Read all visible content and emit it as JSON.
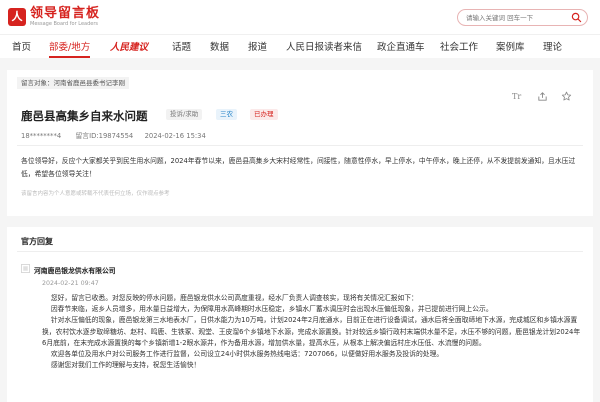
{
  "header": {
    "logo_mark": "人",
    "logo_title": "领导留言板",
    "logo_subtitle": "Message Board for Leaders",
    "search_placeholder": "请输入关键词 回车一下"
  },
  "nav": {
    "items": [
      "首页",
      "部委/地方",
      "人民建议",
      "话题",
      "数据",
      "报道",
      "人民日报读者来信",
      "政企直通车",
      "社会工作",
      "案例库",
      "理论"
    ]
  },
  "message": {
    "breadcrumb": "留言对象：河南省鹿邑县委书记李刚",
    "title": "鹿邑县高集乡自来水问题",
    "tags": [
      "投诉/求助",
      "三农",
      "已办理"
    ],
    "author": "18********4",
    "id_text": "留言ID:19874554",
    "date": "2024-02-16 15:34",
    "font_toggle": "Tr",
    "body": "各位领导好，反应个大家都关乎到民生用水问题，2024年春节以来，鹿邑县高集乡大宋村经常性，间接性，随意性停水，早上停水，中午停水，晚上还停，从不发提前发通知，且水压过低，希望各位领导关注！",
    "disclaimer": "该留言内容为个人意愿或转载不代表任何立场，仅作观点参考"
  },
  "reply": {
    "section_title": "官方回复",
    "org": "河南鹿邑银龙供水有限公司",
    "time": "2024-02-21 09:47",
    "paragraphs": [
      "您好，留言已收悉。对您反映的停水问题，鹿邑银龙供水公司高度重视，经水厂负责人调查核实，现将有关情况汇报如下：",
      "因春节来临，返乡人员增多，用水量日益增大，为保障用水高峰期时水压稳定，乡镇水厂蓄水调压时会出现水压偏低现象，并已提前进行网上公示。",
      "针对水压偏低的现象，鹿邑银龙第三水地表水厂，日供水能力为10万吨，计划2024年2月底通水，目前正在进行设备调试，通水后将全面取缔地下水源，完成城区和乡镇水源置换，农村饮水逐步取缔糖坊、赵村、鸣鹿、生铁冢、观堂、王皮溜6个乡镇地下水源，完成水源置换。针对较远乡镇行政村末端供水量不足，水压不够的问题，鹿邑银龙计划2024年6月底前，在末完成水源置换的每个乡镇新增1-2眼水源井，作为备用水源，增加供水量，提高水压，从根本上解决偏远村庄水压低、水流慢的问题。",
      "欢迎各单位及用水户对公司服务工作进行监督，公司设立24小时供水服务热线电话：7207066，以便做好用水服务及投诉的处理。",
      "感谢您对我们工作的理解与支持，祝您生活愉快！"
    ]
  }
}
